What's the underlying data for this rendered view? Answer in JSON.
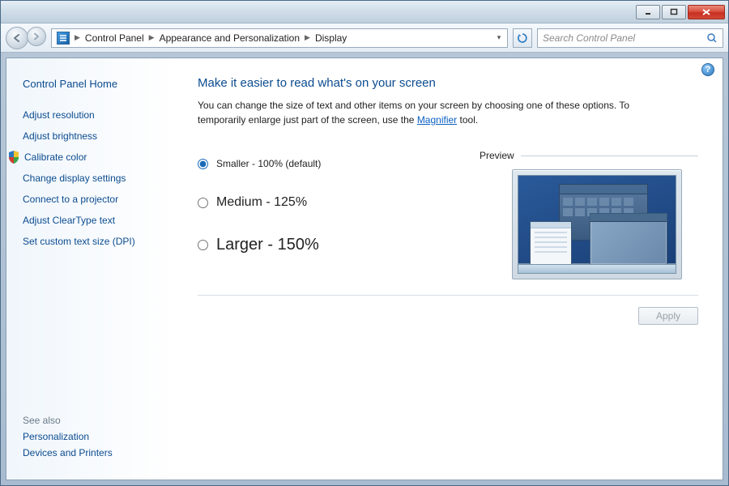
{
  "window": {
    "caption_buttons": {
      "minimize": "minimize",
      "maximize": "maximize",
      "close": "close"
    }
  },
  "addressbar": {
    "crumbs": [
      "Control Panel",
      "Appearance and Personalization",
      "Display"
    ]
  },
  "search": {
    "placeholder": "Search Control Panel"
  },
  "sidebar": {
    "home": "Control Panel Home",
    "links": [
      "Adjust resolution",
      "Adjust brightness",
      "Calibrate color",
      "Change display settings",
      "Connect to a projector",
      "Adjust ClearType text",
      "Set custom text size (DPI)"
    ],
    "see_also_label": "See also",
    "see_also": [
      "Personalization",
      "Devices and Printers"
    ]
  },
  "main": {
    "title": "Make it easier to read what's on your screen",
    "intro_a": "You can change the size of text and other items on your screen by choosing one of these options. To temporarily enlarge just part of the screen, use the ",
    "magnifier_link": "Magnifier",
    "intro_b": " tool.",
    "options": {
      "smaller": "Smaller - 100% (default)",
      "medium": "Medium - 125%",
      "larger": "Larger - 150%",
      "selected": "smaller"
    },
    "preview_label": "Preview",
    "apply_label": "Apply"
  }
}
